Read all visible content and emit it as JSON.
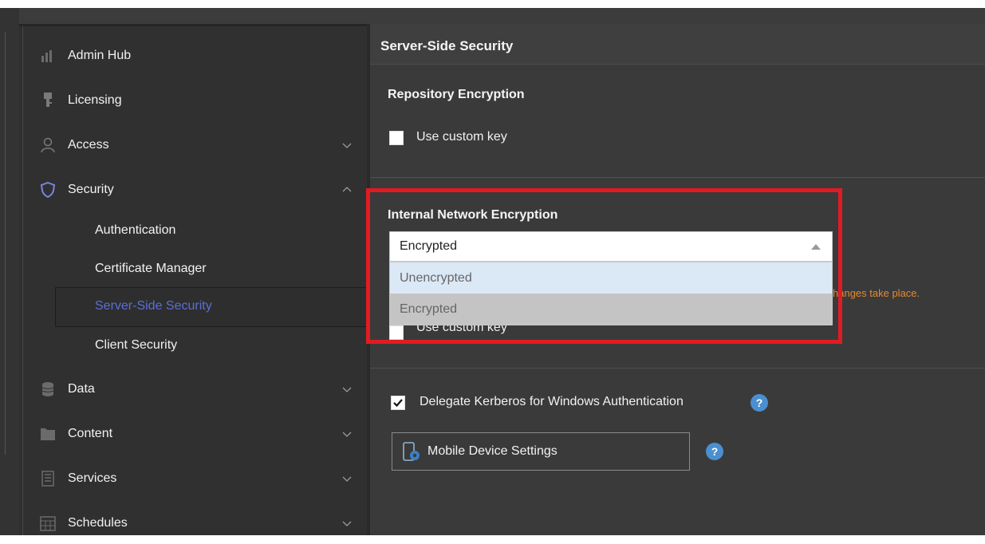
{
  "sidebar": {
    "items": [
      {
        "label": "Admin Hub",
        "icon": "admin-hub-icon"
      },
      {
        "label": "Licensing",
        "icon": "licensing-icon"
      },
      {
        "label": "Access",
        "icon": "user-icon",
        "expanded": false
      },
      {
        "label": "Security",
        "icon": "shield-icon",
        "expanded": true
      },
      {
        "label": "Data",
        "icon": "database-icon",
        "expanded": false
      },
      {
        "label": "Content",
        "icon": "folder-icon",
        "expanded": false
      },
      {
        "label": "Services",
        "icon": "services-icon",
        "expanded": false
      },
      {
        "label": "Schedules",
        "icon": "calendar-icon",
        "expanded": false
      }
    ],
    "security_subitems": [
      {
        "label": "Authentication"
      },
      {
        "label": "Certificate Manager"
      },
      {
        "label": "Server-Side Security",
        "active": true
      },
      {
        "label": "Client Security"
      }
    ]
  },
  "main": {
    "title": "Server-Side Security",
    "repository": {
      "title": "Repository Encryption",
      "custom_key_label": "Use custom key",
      "custom_key_checked": false
    },
    "internal_network": {
      "title": "Internal Network Encryption",
      "selected": "Encrypted",
      "options": [
        "Unencrypted",
        "Encrypted"
      ],
      "hovered_option": "Unencrypted",
      "warning_partial": "hanges take place.",
      "custom_key_label": "Use custom key",
      "custom_key_checked": false
    },
    "kerberos": {
      "label": "Delegate Kerberos for Windows Authentication",
      "checked": true,
      "help": "?"
    },
    "mobile_button": {
      "label": "Mobile Device Settings",
      "help": "?"
    }
  },
  "colors": {
    "accent": "#5b6fd6",
    "warning": "#e58a2f",
    "highlight_box": "#e21b23",
    "help_icon": "#4a8fd0"
  }
}
